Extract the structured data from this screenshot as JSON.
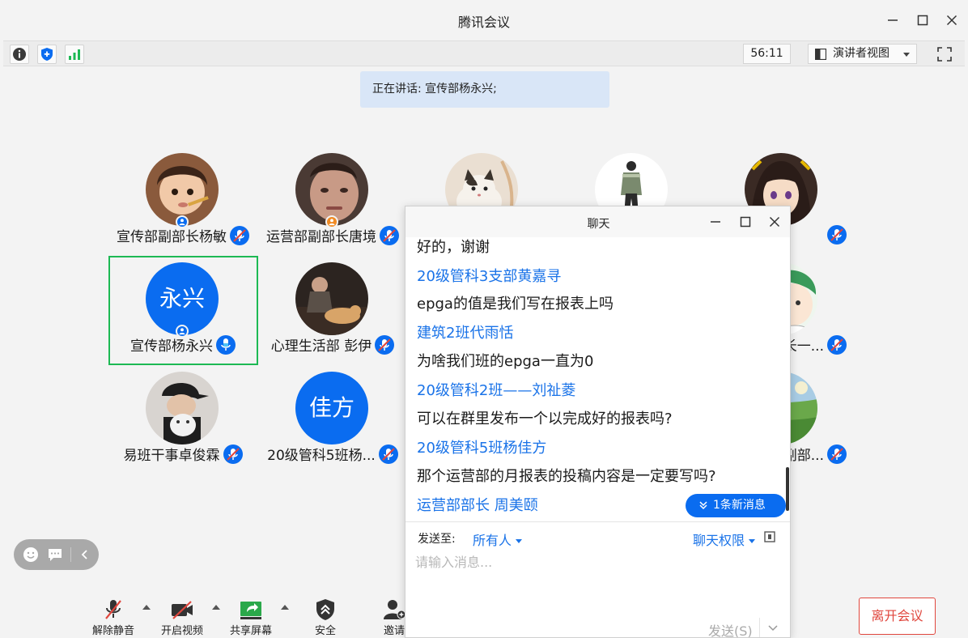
{
  "window": {
    "title": "腾讯会议"
  },
  "infobar": {
    "timer": "56:11",
    "view_label": "演讲者视图"
  },
  "speaking_banner": "正在讲话: 宣传部杨永兴;",
  "colors": {
    "accent": "#0a6cf0",
    "selected_border": "#1db954",
    "leave": "#e0463d",
    "host_badge": "#f08a24"
  },
  "participants": [
    {
      "name": "宣传部副部长杨敏",
      "avatar": "photo-child",
      "role": "cohost",
      "mic": "muted"
    },
    {
      "name": "运营部副部长唐境",
      "avatar": "photo-face",
      "role": "host",
      "mic": "muted"
    },
    {
      "name": "",
      "avatar": "photo-cat",
      "role": "",
      "mic": ""
    },
    {
      "name": "",
      "avatar": "photo-person-standing",
      "role": "",
      "mic": ""
    },
    {
      "name": "",
      "avatar": "photo-anime-girl",
      "role": "",
      "mic": "muted"
    },
    {
      "name": "宣传部杨永兴",
      "avatar_text": "永兴",
      "role": "cohost",
      "mic": "active",
      "selected": true
    },
    {
      "name": "心理生活部 彭伊",
      "avatar": "photo-man-dog",
      "role": "",
      "mic": "muted"
    },
    {
      "name": "长一...",
      "avatar": "photo-anime-boy",
      "role": "",
      "mic": "muted"
    },
    {
      "name": "易班干事卓俊霖",
      "avatar": "photo-cap-cat",
      "role": "",
      "mic": "muted"
    },
    {
      "name": "20级管科5班杨...",
      "avatar_text": "佳方",
      "role": "",
      "mic": "muted"
    },
    {
      "name": "副部...",
      "avatar": "photo-landscape",
      "role": "",
      "mic": "muted"
    }
  ],
  "toolbar": {
    "unmute": "解除静音",
    "video": "开启视频",
    "share": "共享屏幕",
    "security": "安全",
    "invite": "邀请",
    "leave": "离开会议"
  },
  "chat": {
    "title": "聊天",
    "messages": [
      {
        "type": "text",
        "value": "好的，谢谢"
      },
      {
        "type": "sender",
        "value": "20级管科3支部黄嘉寻"
      },
      {
        "type": "text",
        "value": "epga的值是我们写在报表上吗"
      },
      {
        "type": "sender",
        "value": "建筑2班代雨恬"
      },
      {
        "type": "text",
        "value": "为啥我们班的epga一直为0"
      },
      {
        "type": "sender",
        "value": "20级管科2班——刘祉菱"
      },
      {
        "type": "text",
        "value": "可以在群里发布一个以完成好的报表吗?"
      },
      {
        "type": "sender",
        "value": "20级管科5班杨佳方"
      },
      {
        "type": "text",
        "value": "那个运营部的月报表的投稿内容是一定要写吗?"
      },
      {
        "type": "sender",
        "value": "运营部部长 周美颐"
      }
    ],
    "new_messages": "1条新消息",
    "send_to_label": "发送至:",
    "recipient": "所有人",
    "permission": "聊天权限",
    "input_placeholder": "请输入消息...",
    "send_label": "发送(S)"
  }
}
